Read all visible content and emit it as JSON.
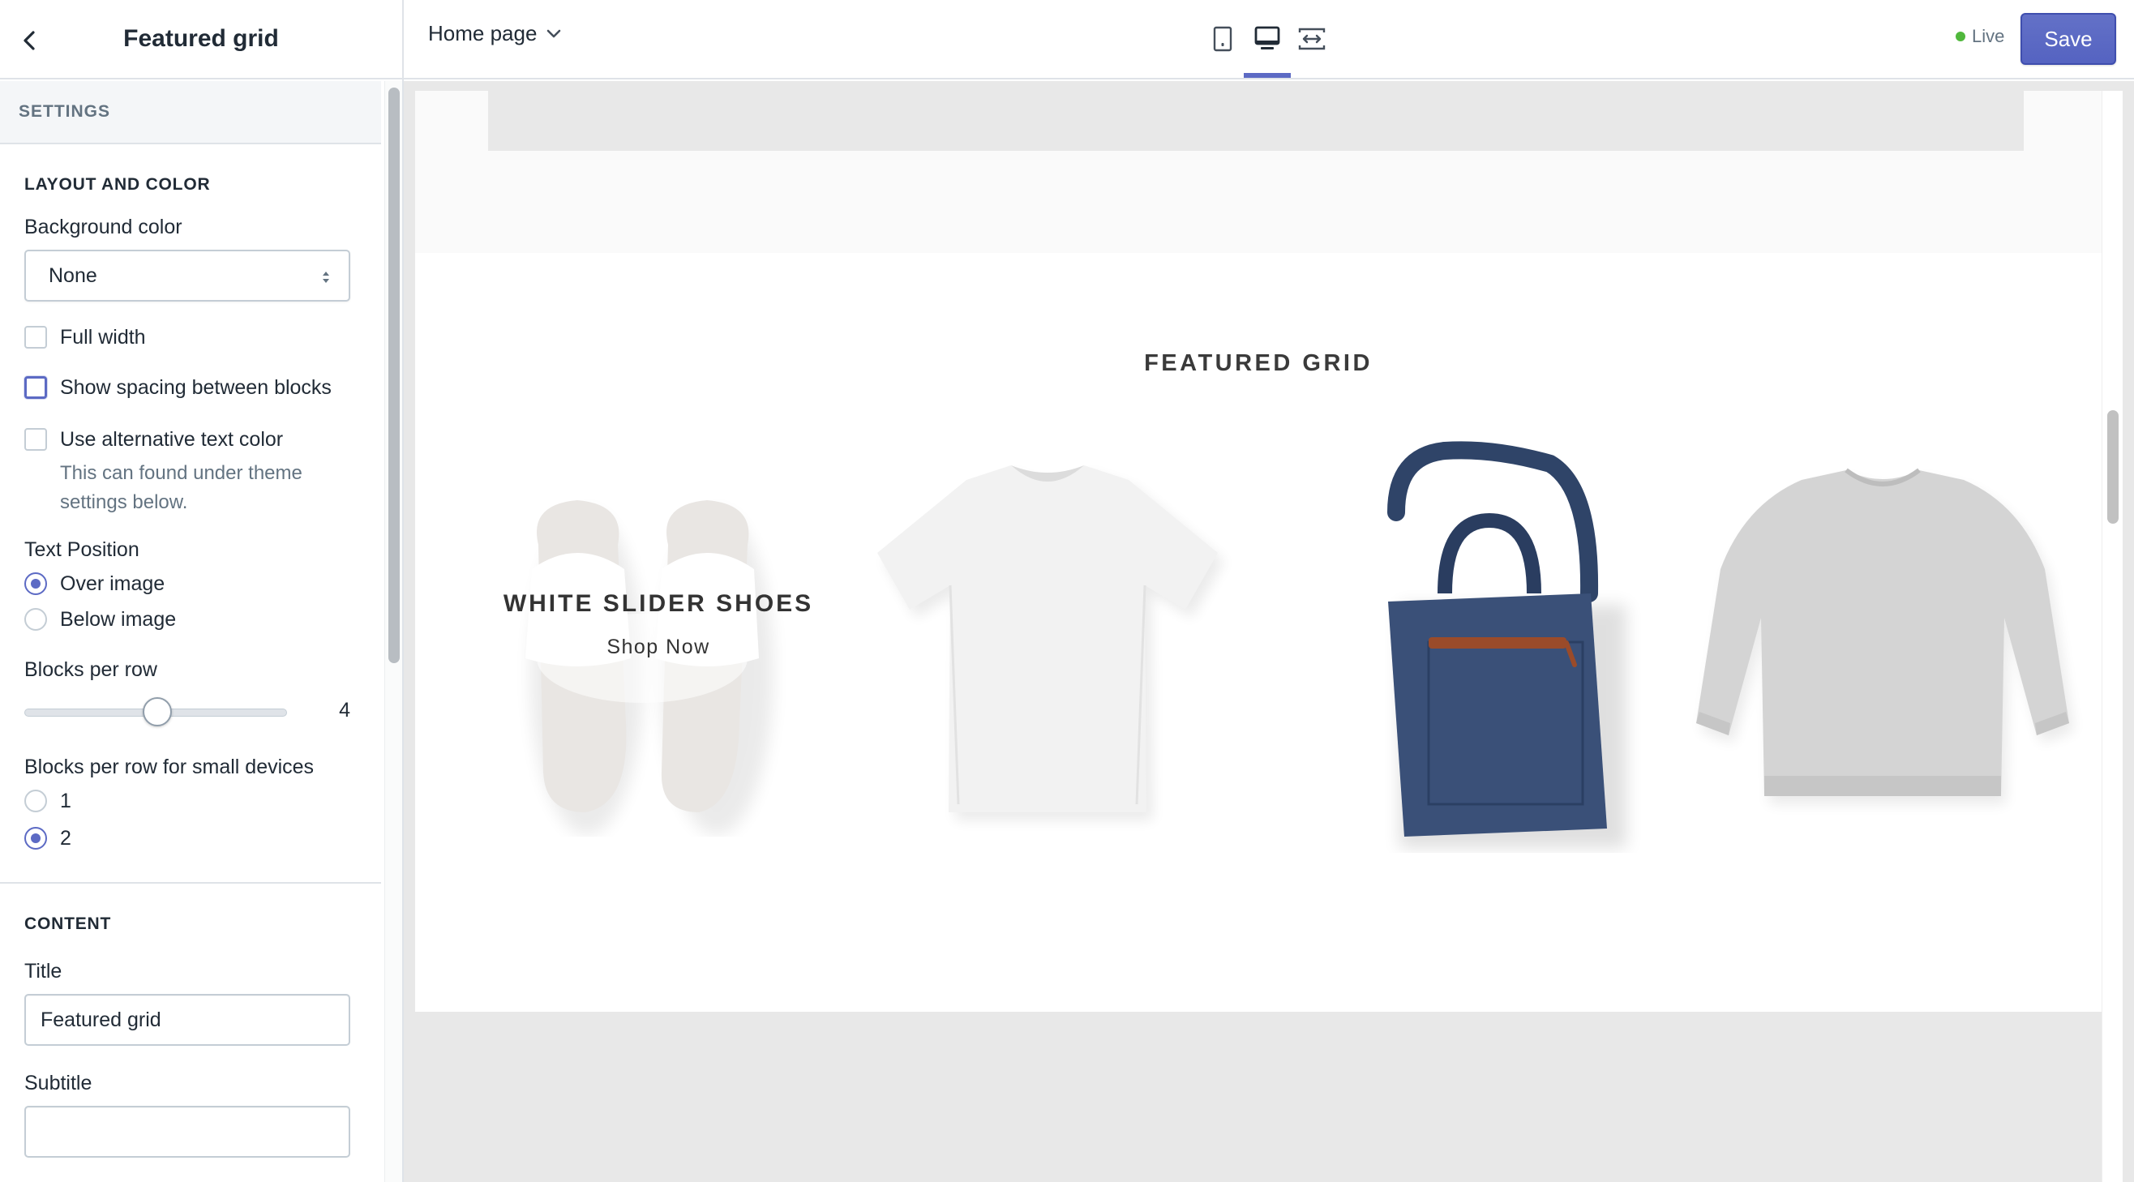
{
  "sidebar": {
    "title": "Featured grid",
    "settings_label": "SETTINGS",
    "layout_section": {
      "heading": "LAYOUT AND COLOR",
      "background_color_label": "Background color",
      "background_color_value": "None",
      "full_width_label": "Full width",
      "show_spacing_label": "Show spacing between blocks",
      "alt_text_color_label": "Use alternative text color",
      "alt_text_color_help": "This can found under theme settings below.",
      "text_position_label": "Text Position",
      "text_position_options": [
        "Over image",
        "Below image"
      ],
      "text_position_selected": "Over image",
      "blocks_per_row_label": "Blocks per row",
      "blocks_per_row_value": "4",
      "blocks_per_row_fraction": 0.5,
      "small_devices_label": "Blocks per row for small devices",
      "small_devices_options": [
        "1",
        "2"
      ],
      "small_devices_selected": "2"
    },
    "content_section": {
      "heading": "CONTENT",
      "title_label": "Title",
      "title_value": "Featured grid",
      "subtitle_label": "Subtitle",
      "subtitle_value": ""
    }
  },
  "topbar": {
    "page_picker": "Home page",
    "status": "Live",
    "save_label": "Save",
    "devices": [
      "mobile-icon",
      "desktop-icon",
      "fullscreen-icon"
    ],
    "active_device": "desktop-icon"
  },
  "preview": {
    "section_title": "FEATURED GRID",
    "products": [
      {
        "name": "white-slider-shoes",
        "overlay_title": "WHITE SLIDER SHOES",
        "overlay_link": "Shop Now"
      },
      {
        "name": "white-t-shirt"
      },
      {
        "name": "navy-tote-bag"
      },
      {
        "name": "grey-sweatshirt"
      }
    ]
  },
  "colors": {
    "accent": "#5c6ac4",
    "live_dot": "#50b83c",
    "border": "#dfe3e8",
    "muted_text": "#637381"
  }
}
